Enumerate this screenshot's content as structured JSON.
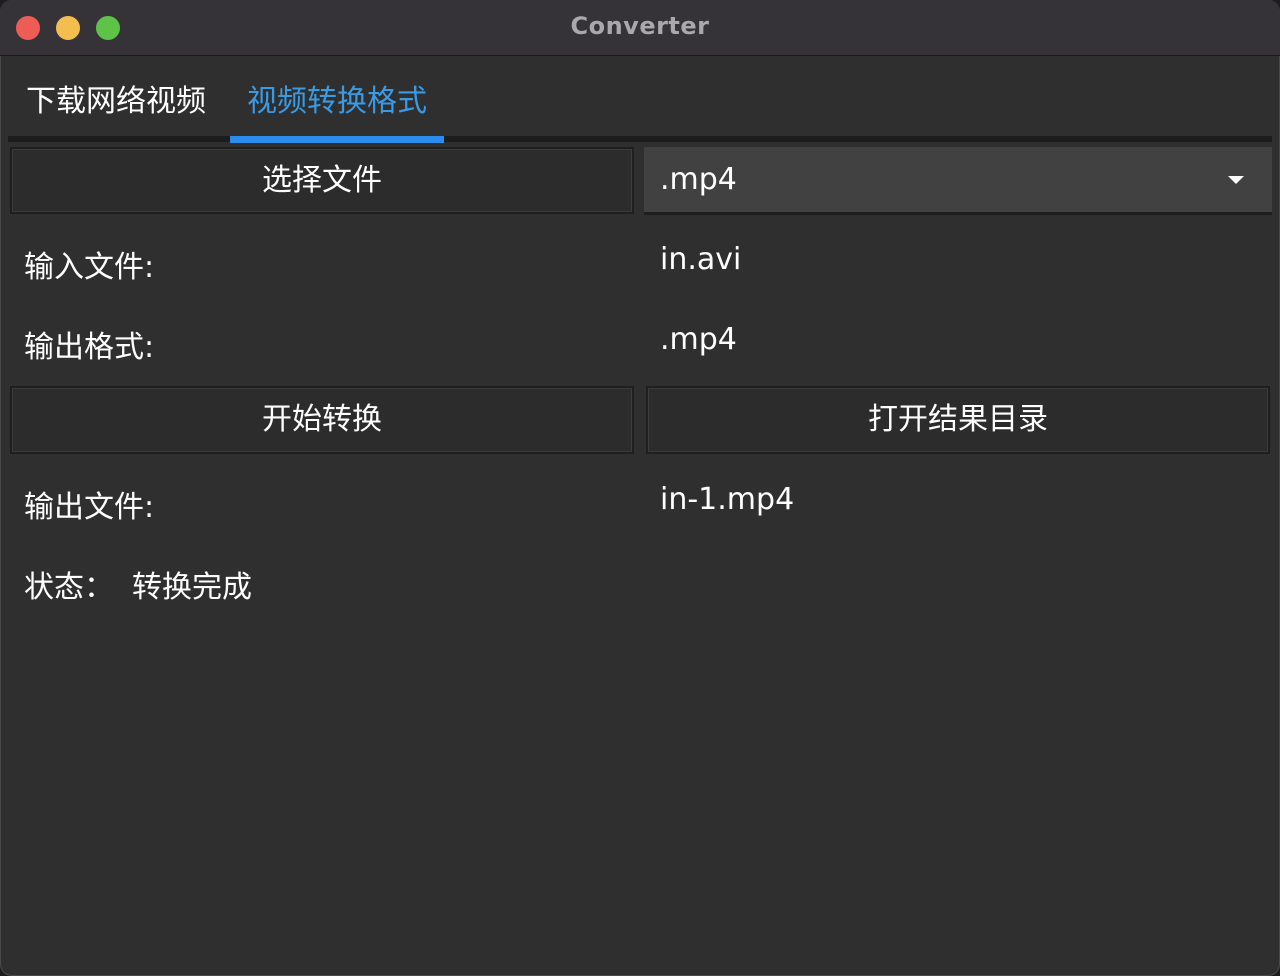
{
  "window": {
    "title": "Converter"
  },
  "tabs": [
    {
      "label": "下载网络视频",
      "active": false
    },
    {
      "label": "视频转换格式",
      "active": true
    }
  ],
  "converter": {
    "select_file_button": "选择文件",
    "format_select": {
      "value": ".mp4",
      "icon": "chevron-down-icon"
    },
    "input_file": {
      "label": "输入文件:",
      "value": "in.avi"
    },
    "output_format": {
      "label": "输出格式:",
      "value": ".mp4"
    },
    "start_button": "开始转换",
    "open_dir_button": "打开结果目录",
    "output_file": {
      "label": "输出文件:",
      "value": "in-1.mp4"
    },
    "status": {
      "label": "状态：",
      "value": "转换完成"
    }
  },
  "colors": {
    "accent": "#2a8cec",
    "active_tab_text": "#3a9ae4",
    "window_bg": "#2f2f2f",
    "titlebar_bg": "#353238",
    "close": "#ee5c56",
    "minimize": "#f4bd4f",
    "maximize": "#5ec449"
  }
}
